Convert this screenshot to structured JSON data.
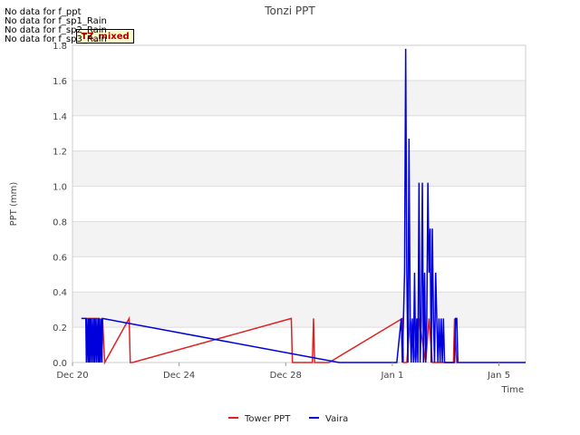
{
  "notices": [
    "No data for f_ppt",
    "No data for f_sp1_Rain",
    "No data for f_sp2_Rain",
    "No data for f_sp3_Rain"
  ],
  "badge": "TZ_mixed",
  "chart_data": {
    "type": "line",
    "title": "Tonzi PPT",
    "xlabel": "Time",
    "ylabel": "PPT (mm)",
    "xlim": [
      "2023-12-20",
      "2024-01-06"
    ],
    "ylim": [
      0,
      1.8
    ],
    "yticks": [
      0.0,
      0.2,
      0.4,
      0.6,
      0.8,
      1.0,
      1.2,
      1.4,
      1.6,
      1.8
    ],
    "ytick_labels": [
      "0.0",
      "0.2",
      "0.4",
      "0.6",
      "0.8",
      "1.0",
      "1.2",
      "1.4",
      "1.6",
      "1.8"
    ],
    "xticks": [
      "2023-12-20",
      "2023-12-24",
      "2023-12-28",
      "2024-01-01",
      "2024-01-05"
    ],
    "xtick_labels": [
      "Dec 20",
      "Dec 24",
      "Dec 28",
      "Jan 1",
      "Jan 5"
    ],
    "grid": true,
    "legend": "bottom-center",
    "series": [
      {
        "name": "Tower PPT",
        "color": "#dd2222",
        "x": [
          "2023-12-20 12:00",
          "2023-12-20 14:00",
          "2023-12-20 16:00",
          "2023-12-21 00:00",
          "2023-12-21 00:05",
          "2023-12-21 03:00",
          "2023-12-21 05:00",
          "2023-12-22 03:00",
          "2023-12-22 04:00",
          "2023-12-22 06:00",
          "2023-12-28 05:00",
          "2023-12-28 06:00",
          "2023-12-29 00:00",
          "2023-12-29 01:00",
          "2023-12-29 02:00",
          "2023-12-29 15:00",
          "2024-01-01 09:00",
          "2024-01-01 10:00",
          "2024-01-01 13:00",
          "2024-01-01 16:00",
          "2024-01-01 21:00",
          "2024-01-02 00:00",
          "2024-01-02 06:00",
          "2024-01-02 09:00",
          "2024-01-02 12:00",
          "2024-01-03 07:00",
          "2024-01-03 08:00",
          "2024-01-03 10:00",
          "2024-01-03 11:00"
        ],
        "values": [
          0.25,
          0.25,
          0.25,
          0.25,
          0.0,
          0.25,
          0.0,
          0.25,
          0.0,
          0.0,
          0.25,
          0.0,
          0.0,
          0.25,
          0.0,
          0.0,
          0.25,
          0.0,
          0.0,
          0.25,
          0.0,
          0.25,
          0.0,
          0.25,
          0.0,
          0.0,
          0.25,
          0.0,
          0.0
        ]
      },
      {
        "name": "Vaira",
        "color": "#0000dd",
        "x": [
          "2023-12-20 08:00",
          "2023-12-20 12:00",
          "2023-12-20 12:30",
          "2023-12-20 13:00",
          "2023-12-20 14:00",
          "2023-12-20 14:30",
          "2023-12-20 15:00",
          "2023-12-20 15:30",
          "2023-12-20 16:00",
          "2023-12-20 16:30",
          "2023-12-20 17:30",
          "2023-12-20 18:00",
          "2023-12-20 19:00",
          "2023-12-20 19:30",
          "2023-12-20 20:00",
          "2023-12-20 20:30",
          "2023-12-20 21:30",
          "2023-12-20 22:00",
          "2023-12-20 23:00",
          "2023-12-20 23:30",
          "2023-12-21 00:00",
          "2023-12-21 00:30",
          "2023-12-21 01:00",
          "2023-12-21 02:00",
          "2023-12-21 02:30",
          "2023-12-21 03:00",
          "2023-12-30 00:00",
          "2024-01-01 04:00",
          "2024-01-01 08:00",
          "2024-01-01 09:00",
          "2024-01-01 10:00",
          "2024-01-01 11:00",
          "2024-01-01 12:00",
          "2024-01-01 13:00",
          "2024-01-01 14:00",
          "2024-01-01 15:00",
          "2024-01-01 16:00",
          "2024-01-01 17:00",
          "2024-01-01 18:00",
          "2024-01-01 19:00",
          "2024-01-01 20:00",
          "2024-01-01 21:00",
          "2024-01-01 22:00",
          "2024-01-01 23:00",
          "2024-01-02 00:00",
          "2024-01-02 01:00",
          "2024-01-02 02:00",
          "2024-01-02 03:00",
          "2024-01-02 04:00",
          "2024-01-02 05:00",
          "2024-01-02 06:00",
          "2024-01-02 07:00",
          "2024-01-02 08:00",
          "2024-01-02 09:00",
          "2024-01-02 10:00",
          "2024-01-02 11:00",
          "2024-01-02 12:00",
          "2024-01-02 13:00",
          "2024-01-02 14:00",
          "2024-01-02 15:00",
          "2024-01-02 16:00",
          "2024-01-02 17:00",
          "2024-01-02 18:00",
          "2024-01-02 19:00",
          "2024-01-02 20:00",
          "2024-01-02 21:00",
          "2024-01-02 22:00",
          "2024-01-02 23:00",
          "2024-01-03 00:00",
          "2024-01-03 01:00",
          "2024-01-03 02:00",
          "2024-01-03 07:00",
          "2024-01-03 08:00",
          "2024-01-03 09:00",
          "2024-01-03 10:00",
          "2024-01-03 11:00",
          "2024-01-06 00:00"
        ],
        "values": [
          0.25,
          0.25,
          0.0,
          0.25,
          0.0,
          0.25,
          0.0,
          0.25,
          0.0,
          0.25,
          0.0,
          0.25,
          0.0,
          0.25,
          0.0,
          0.25,
          0.0,
          0.25,
          0.0,
          0.25,
          0.0,
          0.25,
          0.0,
          0.25,
          0.0,
          0.25,
          0.0,
          0.0,
          0.25,
          0.0,
          0.25,
          0.51,
          1.78,
          0.51,
          0.0,
          1.27,
          0.25,
          0.0,
          0.25,
          0.0,
          0.51,
          0.0,
          0.25,
          0.0,
          1.02,
          0.0,
          0.25,
          1.02,
          0.0,
          0.51,
          0.0,
          0.25,
          1.02,
          0.51,
          0.76,
          0.0,
          0.76,
          0.25,
          0.0,
          0.51,
          0.25,
          0.0,
          0.25,
          0.0,
          0.25,
          0.0,
          0.25,
          0.0,
          0.0,
          0.0,
          0.0,
          0.0,
          0.0,
          0.25,
          0.25,
          0.0,
          0.0
        ]
      }
    ]
  }
}
